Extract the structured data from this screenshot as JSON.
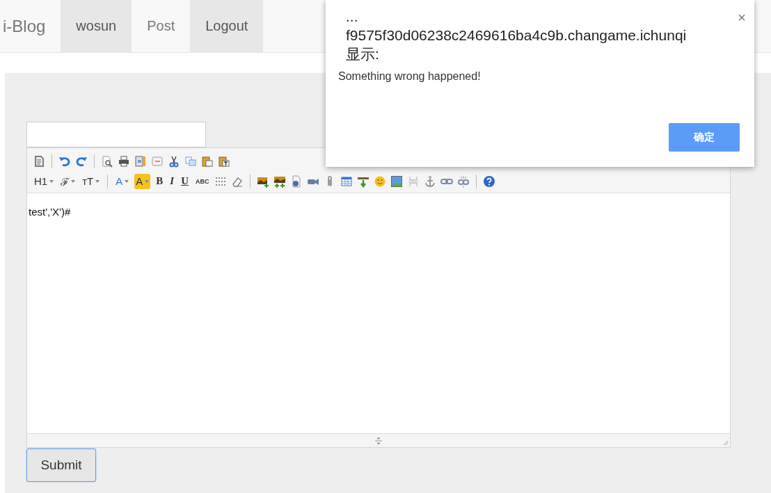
{
  "navbar": {
    "brand": "i-Blog",
    "items": [
      {
        "label": "wosun",
        "selected": true
      },
      {
        "label": "Post",
        "selected": false
      },
      {
        "label": "Logout",
        "selected": true
      }
    ]
  },
  "form": {
    "toolbar": {
      "rows": [
        [
          {
            "kind": "source"
          },
          {
            "kind": "sep"
          },
          {
            "kind": "undo"
          },
          {
            "kind": "redo"
          },
          {
            "kind": "sep"
          },
          {
            "kind": "preview"
          },
          {
            "kind": "print"
          },
          {
            "kind": "template"
          },
          {
            "kind": "code"
          },
          {
            "kind": "cut"
          },
          {
            "kind": "copy"
          },
          {
            "kind": "paste"
          },
          {
            "kind": "pastetext"
          }
        ],
        [
          {
            "kind": "heading",
            "label": "H1"
          },
          {
            "kind": "font",
            "label": "ℱ"
          },
          {
            "kind": "size",
            "label": "ᴛT"
          },
          {
            "kind": "sep"
          },
          {
            "kind": "forecolor",
            "label": "A"
          },
          {
            "kind": "backcolor",
            "label": "A"
          },
          {
            "kind": "bold",
            "label": "B"
          },
          {
            "kind": "italic",
            "label": "I"
          },
          {
            "kind": "underline",
            "label": "U"
          },
          {
            "kind": "strike",
            "label": "ABC"
          },
          {
            "kind": "hr"
          },
          {
            "kind": "eraser"
          },
          {
            "kind": "sep"
          },
          {
            "kind": "image"
          },
          {
            "kind": "multiimage"
          },
          {
            "kind": "file"
          },
          {
            "kind": "video"
          },
          {
            "kind": "attach"
          },
          {
            "kind": "table"
          },
          {
            "kind": "insertrow"
          },
          {
            "kind": "emoticon"
          },
          {
            "kind": "picture"
          },
          {
            "kind": "pagebreak"
          },
          {
            "kind": "anchor"
          },
          {
            "kind": "link"
          },
          {
            "kind": "unlink"
          },
          {
            "kind": "sep"
          },
          {
            "kind": "help"
          }
        ]
      ]
    },
    "content": "test','X')#",
    "submit": "Submit"
  },
  "dialog": {
    "origin_lines": [
      "...",
      "f9575f30d06238c2469616ba4c9b.changame.ichunqi",
      "显示:"
    ],
    "message": "Something wrong happened!",
    "close": "×",
    "ok": "确定"
  }
}
